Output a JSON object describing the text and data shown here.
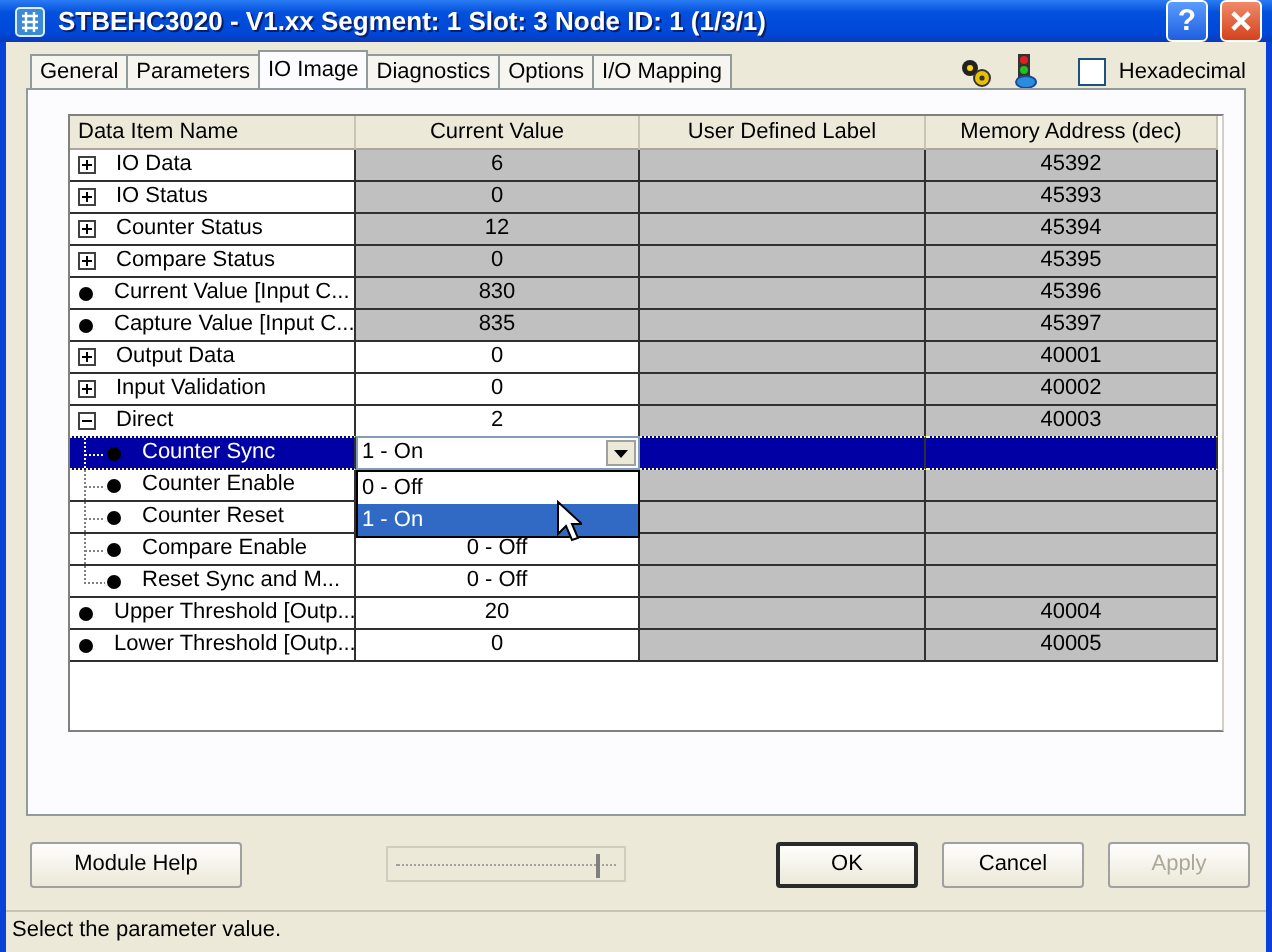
{
  "window": {
    "title": "STBEHC3020 - V1.xx Segment: 1 Slot: 3 Node ID: 1 (1/3/1)",
    "help": "?"
  },
  "tabs": [
    {
      "label": "General",
      "selected": false
    },
    {
      "label": "Parameters",
      "selected": false
    },
    {
      "label": "IO Image",
      "selected": true
    },
    {
      "label": "Diagnostics",
      "selected": false
    },
    {
      "label": "Options",
      "selected": false
    },
    {
      "label": "I/O Mapping",
      "selected": false
    }
  ],
  "hexadecimal": {
    "label": "Hexadecimal",
    "checked": false
  },
  "table": {
    "columns": [
      "Data Item Name",
      "Current Value",
      "User Defined Label",
      "Memory Address (dec)"
    ],
    "rows": [
      {
        "kind": "group",
        "name": "IO Data",
        "expanded": false,
        "value": "6",
        "editable": false,
        "address": "45392",
        "selected": false
      },
      {
        "kind": "group",
        "name": "IO Status",
        "expanded": false,
        "value": "0",
        "editable": false,
        "address": "45393",
        "selected": false
      },
      {
        "kind": "group",
        "name": "Counter Status",
        "expanded": false,
        "value": "12",
        "editable": false,
        "address": "45394",
        "selected": false
      },
      {
        "kind": "group",
        "name": "Compare Status",
        "expanded": false,
        "value": "0",
        "editable": false,
        "address": "45395",
        "selected": false
      },
      {
        "kind": "item",
        "name": "Current Value [Input C...",
        "value": "830",
        "editable": false,
        "address": "45396",
        "selected": false
      },
      {
        "kind": "item",
        "name": "Capture Value [Input C...",
        "value": "835",
        "editable": false,
        "address": "45397",
        "selected": false
      },
      {
        "kind": "group",
        "name": "Output Data",
        "expanded": false,
        "value": "0",
        "editable": true,
        "address": "40001",
        "selected": false
      },
      {
        "kind": "group",
        "name": "Input Validation",
        "expanded": false,
        "value": "0",
        "editable": true,
        "address": "40002",
        "selected": false
      },
      {
        "kind": "group",
        "name": "Direct",
        "expanded": true,
        "value": "2",
        "editable": true,
        "address": "40003",
        "selected": false,
        "children": [
          {
            "kind": "item",
            "name": "Counter Sync",
            "selected": true,
            "editor": {
              "value": "1 - On",
              "options": [
                {
                  "label": "0 - Off",
                  "selected": false
                },
                {
                  "label": "1 - On",
                  "selected": true
                }
              ]
            }
          },
          {
            "kind": "item",
            "name": "Counter Enable",
            "selected": false
          },
          {
            "kind": "item",
            "name": "Counter Reset",
            "selected": false
          },
          {
            "kind": "item",
            "name": "Compare Enable",
            "value": "0 - Off",
            "editable": true,
            "selected": false
          },
          {
            "kind": "item",
            "name": "Reset Sync and M...",
            "value": "0 - Off",
            "editable": true,
            "selected": false
          }
        ]
      },
      {
        "kind": "item",
        "name": "Upper Threshold [Outp...",
        "value": "20",
        "editable": true,
        "address": "40004",
        "selected": false
      },
      {
        "kind": "item",
        "name": "Lower Threshold [Outp...",
        "value": "0",
        "editable": true,
        "address": "40005",
        "selected": false
      }
    ]
  },
  "buttons": [
    {
      "label": "Module Help",
      "default": false,
      "disabled": false
    },
    {
      "label": "OK",
      "default": true,
      "disabled": false
    },
    {
      "label": "Cancel",
      "default": false,
      "disabled": false
    },
    {
      "label": "Apply",
      "default": false,
      "disabled": true
    }
  ],
  "slider": {
    "level": 0.88
  },
  "status_bar": "Select the parameter value."
}
